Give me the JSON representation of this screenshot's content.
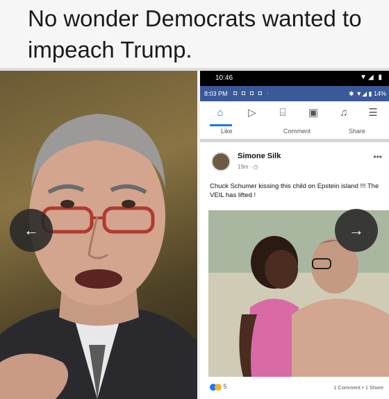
{
  "caption": "No wonder Democrats wanted to impeach Trump.",
  "phone": {
    "status_time": "10:46",
    "status_signal": "▼◢ ▮",
    "inner_status_time": "8:03 PM",
    "inner_status_icons": "◘ ◘ ◘ ◘ ·",
    "inner_status_right": "✱ ▼◢ ▮ 14%",
    "actions": {
      "like": "Like",
      "comment": "Comment",
      "share": "Share"
    },
    "post": {
      "author": "Simone Silk",
      "meta": "19m · ◷",
      "more": "•••",
      "text": "Chuck Schumer kissing this child on Epstein island !!! The VEIL has lifted !",
      "reaction_count": "5",
      "comments_shares": "1 Comment • 1 Share"
    }
  },
  "nav": {
    "prev": "←",
    "next": "→"
  }
}
